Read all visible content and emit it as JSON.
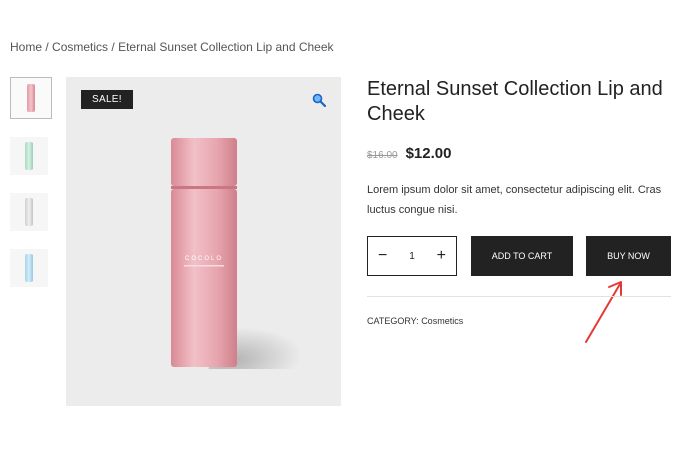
{
  "breadcrumb": {
    "home": "Home",
    "sep1": " / ",
    "category": "Cosmetics",
    "sep2": " / ",
    "current": "Eternal Sunset Collection Lip and Cheek"
  },
  "gallery": {
    "sale_badge": "SALE!",
    "zoom_icon": "magnifier-icon",
    "thumbnail_colors": [
      "#e9a9b1",
      "#bfe6d2",
      "#d8d8d8",
      "#b9dff0"
    ],
    "bottle_text": "COCOLO"
  },
  "product": {
    "title": "Eternal Sunset Collection Lip and Cheek",
    "old_price": "$16.00",
    "price": "$12.00",
    "description": "Lorem ipsum dolor sit amet, consectetur adipiscing elit. Cras luctus congue nisi.",
    "quantity": "1",
    "minus": "−",
    "plus": "+",
    "add_to_cart": "ADD TO CART",
    "buy_now": "BUY NOW",
    "category_label": "CATEGORY: ",
    "category_value": "Cosmetics"
  },
  "colors": {
    "button_bg": "#222222",
    "arrow": "#e53935",
    "main_bg": "#ececec"
  }
}
